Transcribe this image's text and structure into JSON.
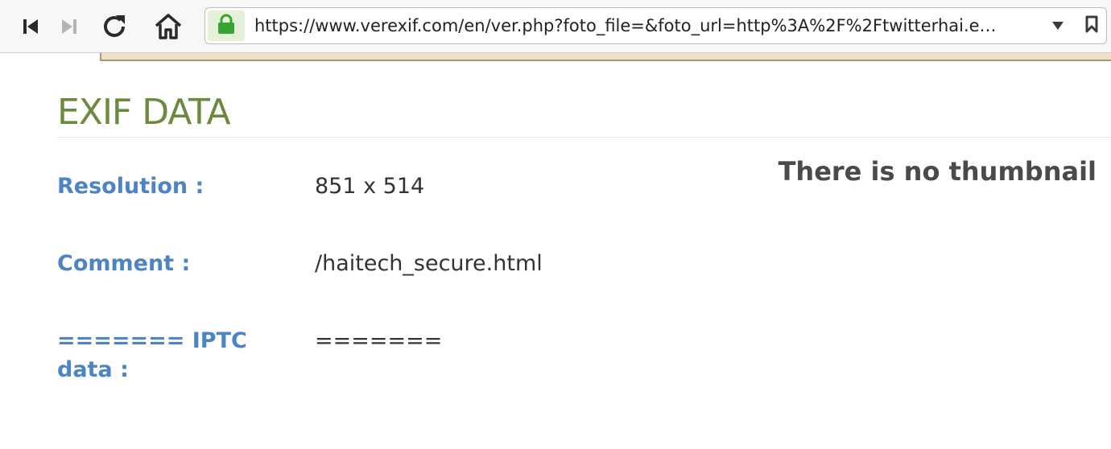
{
  "browser": {
    "url": "https://www.verexif.com/en/ver.php?foto_file=&foto_url=http%3A%2F%2Ftwitterhai.e…",
    "icons": {
      "back": "skip-back-icon",
      "forward": "skip-forward-icon",
      "reload": "reload-icon",
      "home": "home-icon",
      "lock": "lock-icon",
      "dropdown": "chevron-down-icon",
      "bookmark": "bookmark-icon"
    },
    "colors": {
      "lock": "#3aa335",
      "lock_bg": "#e4f0d8"
    }
  },
  "page": {
    "title": "EXIF DATA",
    "thumbnail_message": "There is no thumbnail",
    "fields": [
      {
        "label": "Resolution :",
        "value": "851 x 514"
      },
      {
        "label": "Comment :",
        "value": "/haitech_secure.html"
      },
      {
        "label": "======= IPTC data :",
        "value": "======="
      }
    ],
    "colors": {
      "title": "#6b8a3f",
      "label": "#4d84c4",
      "value": "#333333"
    }
  }
}
